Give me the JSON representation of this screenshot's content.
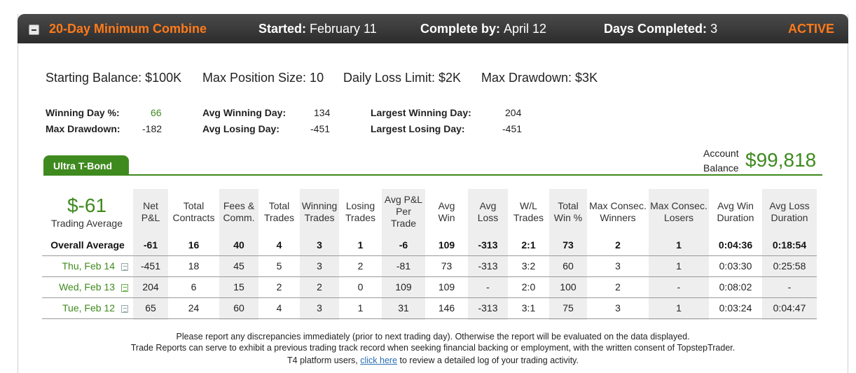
{
  "header": {
    "title": "20-Day Minimum Combine",
    "started_label": "Started:",
    "started_value": "February 11",
    "complete_label": "Complete by:",
    "complete_value": "April 12",
    "days_label": "Days Completed:",
    "days_value": "3",
    "status": "ACTIVE"
  },
  "rules": {
    "starting_balance": "Starting Balance: $100K",
    "max_position": "Max Position Size: 10",
    "daily_loss": "Daily Loss Limit: $2K",
    "max_drawdown": "Max Drawdown: $3K"
  },
  "stats": {
    "winning_day_label": "Winning Day %:",
    "winning_day_value": "66",
    "max_drawdown_label": "Max Drawdown:",
    "max_drawdown_value": "-182",
    "avg_winning_label": "Avg Winning Day:",
    "avg_winning_value": "134",
    "avg_losing_label": "Avg Losing Day:",
    "avg_losing_value": "-451",
    "largest_winning_label": "Largest Winning Day:",
    "largest_winning_value": "204",
    "largest_losing_label": "Largest Losing Day:",
    "largest_losing_value": "-451"
  },
  "tab": {
    "label": "Ultra T-Bond"
  },
  "account": {
    "label_line1": "Account",
    "label_line2": "Balance",
    "value": "$99,818"
  },
  "trading_average": {
    "value": "$-61",
    "label": "Trading Average"
  },
  "columns": [
    {
      "l1": "Net",
      "l2": "P&L",
      "l3": ""
    },
    {
      "l1": "Total",
      "l2": "Contracts",
      "l3": ""
    },
    {
      "l1": "Fees &",
      "l2": "Comm.",
      "l3": ""
    },
    {
      "l1": "Total",
      "l2": "Trades",
      "l3": ""
    },
    {
      "l1": "Winning",
      "l2": "Trades",
      "l3": ""
    },
    {
      "l1": "Losing",
      "l2": "Trades",
      "l3": ""
    },
    {
      "l1": "Avg P&L",
      "l2": "Per",
      "l3": "Trade"
    },
    {
      "l1": "Avg",
      "l2": "Win",
      "l3": ""
    },
    {
      "l1": "Avg",
      "l2": "Loss",
      "l3": ""
    },
    {
      "l1": "W/L",
      "l2": "Trades",
      "l3": ""
    },
    {
      "l1": "Total",
      "l2": "Win %",
      "l3": ""
    },
    {
      "l1": "Max Consec.",
      "l2": "Winners",
      "l3": ""
    },
    {
      "l1": "Max Consec.",
      "l2": "Losers",
      "l3": ""
    },
    {
      "l1": "Avg Win",
      "l2": "Duration",
      "l3": ""
    },
    {
      "l1": "Avg Loss",
      "l2": "Duration",
      "l3": ""
    }
  ],
  "overall": {
    "label": "Overall Average",
    "cells": [
      "-61",
      "16",
      "40",
      "4",
      "3",
      "1",
      "-6",
      "109",
      "-313",
      "2:1",
      "73",
      "2",
      "1",
      "0:04:36",
      "0:18:54"
    ]
  },
  "rows": [
    {
      "date": "Thu, Feb 14",
      "cells": [
        "-451",
        "18",
        "45",
        "5",
        "3",
        "2",
        "-81",
        "73",
        "-313",
        "3:2",
        "60",
        "3",
        "1",
        "0:03:30",
        "0:25:58"
      ]
    },
    {
      "date": "Wed, Feb 13",
      "cells": [
        "204",
        "6",
        "15",
        "2",
        "2",
        "0",
        "109",
        "109",
        "-",
        "2:0",
        "100",
        "2",
        "-",
        "0:08:02",
        "-"
      ]
    },
    {
      "date": "Tue, Feb 12",
      "cells": [
        "65",
        "24",
        "60",
        "4",
        "3",
        "1",
        "31",
        "146",
        "-313",
        "3:1",
        "75",
        "3",
        "1",
        "0:03:24",
        "0:04:47"
      ]
    }
  ],
  "footer": {
    "line1": "Please report any discrepancies immediately (prior to next trading day). Otherwise the report will be evaluated on the data displayed.",
    "line2": "Trade Reports can serve to exhibit a previous trading track record when seeking financial backing or employment, with the written consent of TopstepTrader.",
    "line3_pre": "T4 platform users, ",
    "line3_link": "click here",
    "line3_post": " to review a detailed log of your trading activity."
  },
  "colors": {
    "accent_orange": "#ff7a1a",
    "positive_green": "#3f8a1f",
    "negative_red": "#e01010"
  },
  "icons": {
    "collapse": "minus-box-icon",
    "note": "note-icon"
  }
}
